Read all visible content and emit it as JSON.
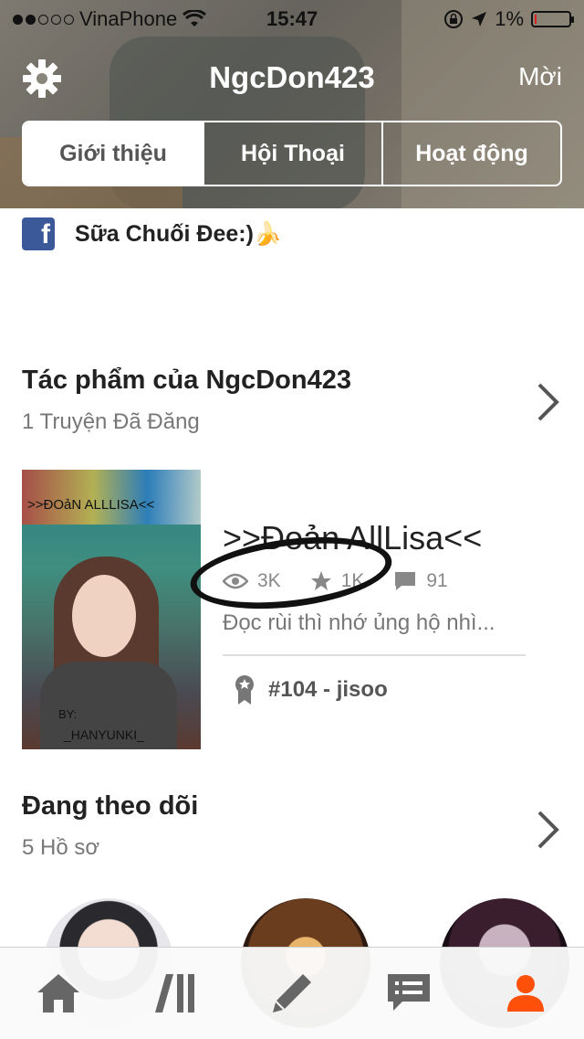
{
  "status_bar": {
    "carrier": "VinaPhone",
    "time": "15:47",
    "battery": "1%",
    "battery_level": 0.01,
    "signal_icon": "signal-dots-icon",
    "wifi_icon": "wifi-icon",
    "lock_icon": "orientation-lock-icon",
    "location_icon": "location-arrow-icon"
  },
  "header": {
    "title": "NgcDon423",
    "invite_label": "Mời",
    "settings_icon": "gear-icon"
  },
  "tabs": [
    {
      "label": "Giới thiệu",
      "active": true
    },
    {
      "label": "Hội Thoại",
      "active": false
    },
    {
      "label": "Hoạt động",
      "active": false
    }
  ],
  "facebook": {
    "icon": "facebook-icon",
    "text": "Sữa Chuối Đee:)🍌"
  },
  "works_section": {
    "title": "Tác phẩm của NgcDon423",
    "subtitle": "1 Truyện Đã Đăng",
    "chevron_icon": "chevron-right-icon"
  },
  "story": {
    "cover_title": ">>ĐOảN ALLLISA<<",
    "cover_by": "BY:",
    "cover_author": "_HANYUNKI_",
    "title": ">>Đoản AllLisa<<",
    "reads": "3K",
    "votes": "1K",
    "comments": "91",
    "description": "Đọc rùi thì nhớ ủng hộ nhì...",
    "rank": "#104 - jisoo",
    "rank_icon": "award-ribbon-icon"
  },
  "following_section": {
    "title": "Đang theo dõi",
    "subtitle": "5 Hồ sơ",
    "chevron_icon": "chevron-right-icon"
  },
  "tab_bar": [
    {
      "name": "home-icon"
    },
    {
      "name": "library-icon"
    },
    {
      "name": "write-pencil-icon"
    },
    {
      "name": "messages-icon"
    },
    {
      "name": "profile-icon",
      "active": true,
      "color": "#ff500a"
    }
  ],
  "colors": {
    "accent": "#ff500a",
    "facebook": "#3b5998"
  }
}
